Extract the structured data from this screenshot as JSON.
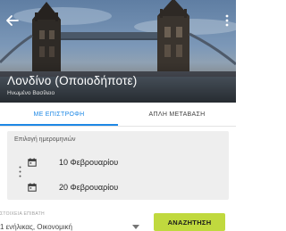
{
  "hero": {
    "city_title": "Λονδίνο (Οποιοδήποτε)",
    "country": "Ηνωμένο Βασίλειο",
    "back_icon": "arrow-left-icon",
    "menu_icon": "more-vertical-icon"
  },
  "tabs": [
    {
      "label": "ΜΕ ΕΠΙΣΤΡΟΦΗ",
      "active": true
    },
    {
      "label": "ΑΠΛΗ ΜΕΤΑΒΑΣΗ",
      "active": false
    }
  ],
  "dates": {
    "label": "Επιλογή ημερομηνιών",
    "departure": "10 Φεβρουαρίου",
    "return": "20 Φεβρουαρίου",
    "icon": "calendar-icon"
  },
  "passengers": {
    "label": "ΣΤΟΙΧΕΙΑ ΕΠΙΒΑΤΗ",
    "value": "1 ενήλικας, Οικονομική"
  },
  "search": {
    "label": "ΑΝΑΖΗΤΗΣΗ"
  },
  "colors": {
    "accent": "#1e88e5",
    "search_button": "#c0d93e",
    "card_background": "#eeeeee"
  }
}
